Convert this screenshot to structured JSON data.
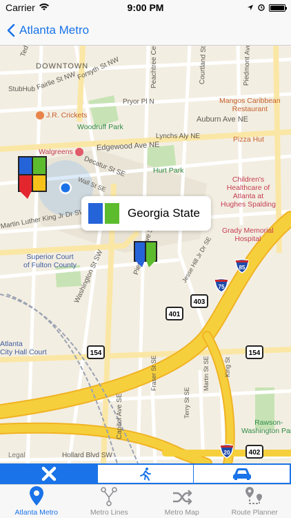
{
  "status_bar": {
    "carrier": "Carrier",
    "time": "9:00 PM"
  },
  "nav": {
    "back_label": "Atlanta Metro"
  },
  "map": {
    "streets": [
      "Ted Turner Dr",
      "DOWNTOWN",
      "Forsyth St NW",
      "StubHub",
      "Fairlie St NW",
      "Peachtree Center",
      "Courtland St NE",
      "Piedmont Ave NE",
      "Pryor Pl N",
      "Auburn Ave NE",
      "Lynchs Aly NE",
      "Edgewood Ave NE",
      "Decatur St SE",
      "Wall St SE",
      "Martin Luther King Jr Dr SW",
      "Washington St SW",
      "Piedmont Ave SE",
      "Jesse Hill Jr Dr SE",
      "Capitol Ave SE",
      "Fraser St SE",
      "Martin St SE",
      "Terry St SE",
      "King St",
      "Hollard Blvd SW",
      "Legal"
    ],
    "pois": [
      {
        "name": "J.R. Crickets",
        "color": "#e8844a"
      },
      {
        "name": "Woodruff Park",
        "color": "#3aa655"
      },
      {
        "name": "Walgreens",
        "color": "#e05a6a"
      },
      {
        "name": "Hurt Park",
        "color": "#3aa655"
      },
      {
        "name": "Mangos Caribbean\nRestaurant",
        "color": "#e8844a"
      },
      {
        "name": "Pizza Hut",
        "color": "#e8844a"
      },
      {
        "name": "Children's\nHealthcare of\nAtlanta at\nHughes Spalding",
        "color": "#e05a6a"
      },
      {
        "name": "Grady Memorial\nHospital",
        "color": "#e05a6a"
      },
      {
        "name": "Superior Court\nof Fulton County",
        "color": "#4d6fb5"
      },
      {
        "name": "Atlanta\nCity Hall Court",
        "color": "#4d6fb5"
      },
      {
        "name": "Rawson-\nWashington Park",
        "color": "#3aa655"
      }
    ],
    "shields": [
      "85",
      "75",
      "403",
      "401",
      "154",
      "154",
      "20",
      "402"
    ],
    "callout": {
      "title": "Georgia State"
    }
  },
  "segments": [
    {
      "label": "Close",
      "icon": "close-icon",
      "active": true
    },
    {
      "label": "Walk",
      "icon": "walk-icon",
      "active": false
    },
    {
      "label": "Drive",
      "icon": "car-icon",
      "active": false
    }
  ],
  "tabs": [
    {
      "label": "Atlanta Metro",
      "icon": "location-pin-icon",
      "active": true
    },
    {
      "label": "Metro Lines",
      "icon": "metro-lines-icon",
      "active": false
    },
    {
      "label": "Metro Map",
      "icon": "shuffle-icon",
      "active": false
    },
    {
      "label": "Route Planner",
      "icon": "route-planner-icon",
      "active": false
    }
  ],
  "colors": {
    "accent": "#1a73e8",
    "marta_blue": "#2563d9",
    "marta_green": "#5dbb2e",
    "marta_red": "#e3262e",
    "marta_yellow": "#f6c21a",
    "interstate": "#f4c31f"
  }
}
